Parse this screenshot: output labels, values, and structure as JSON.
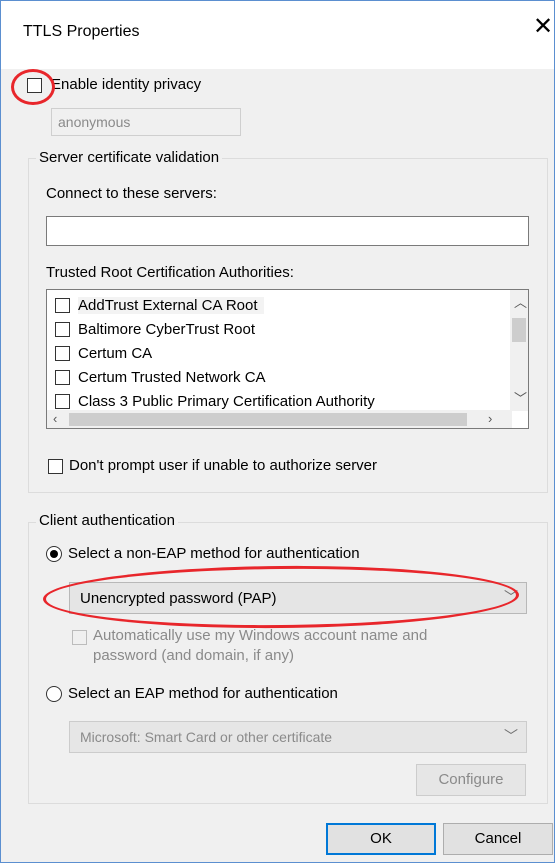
{
  "window": {
    "title": "TTLS Properties"
  },
  "identity": {
    "enable_label": "Enable identity privacy",
    "value": "anonymous"
  },
  "server": {
    "group_label": "Server certificate validation",
    "connect_label": "Connect to these servers:",
    "connect_value": "",
    "trusted_label": "Trusted Root Certification Authorities:",
    "cas": [
      "AddTrust External CA Root",
      "Baltimore CyberTrust Root",
      "Certum CA",
      "Certum Trusted Network CA",
      "Class 3 Public Primary Certification Authority"
    ],
    "dont_prompt_label": "Don't prompt user if unable to authorize server"
  },
  "client": {
    "group_label": "Client authentication",
    "non_eap_label": "Select a non-EAP method for authentication",
    "non_eap_selected": true,
    "non_eap_value": "Unencrypted password (PAP)",
    "auto_use_line1": "Automatically use my Windows account name and",
    "auto_use_line2": "password (and domain, if any)",
    "eap_label": "Select an EAP method for authentication",
    "eap_value": "Microsoft: Smart Card or other certificate",
    "configure_label": "Configure"
  },
  "footer": {
    "ok_label": "OK",
    "cancel_label": "Cancel"
  },
  "colors": {
    "accent": "#0078d7",
    "annotation": "#e8262b"
  }
}
